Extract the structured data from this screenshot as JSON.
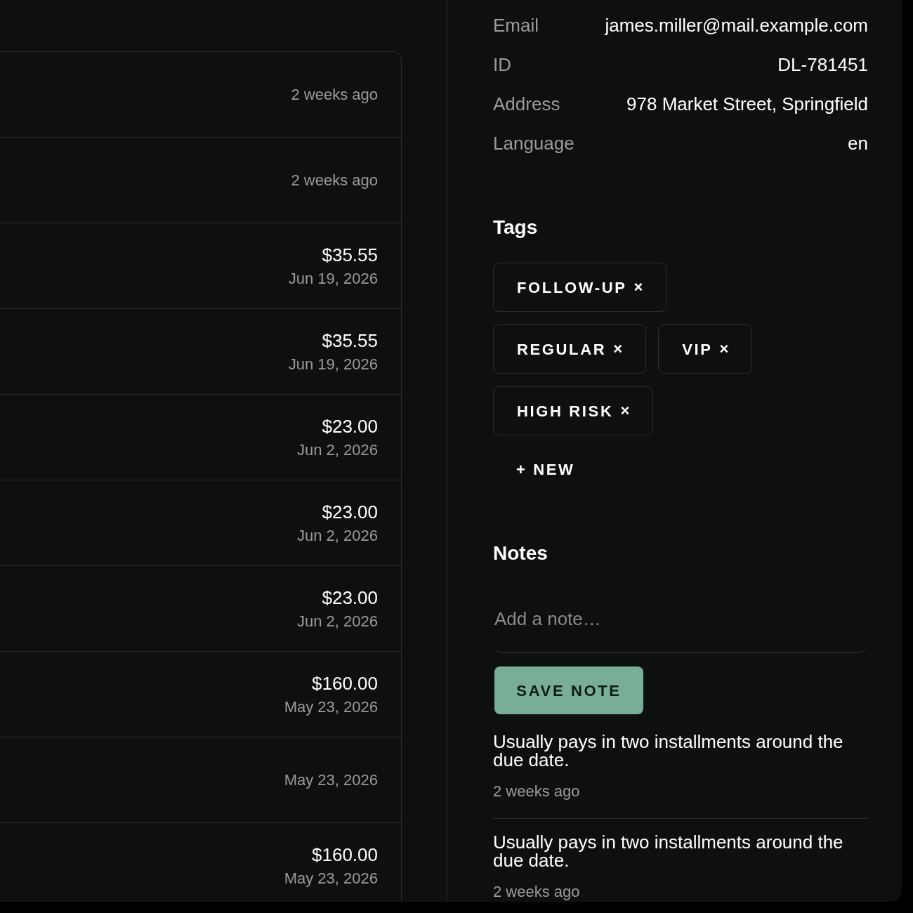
{
  "activity": [
    {
      "date": "2 weeks ago"
    },
    {
      "date": "2 weeks ago"
    },
    {
      "amount": "$35.55",
      "date": "Jun 19, 2026"
    },
    {
      "amount": "$35.55",
      "date": "Jun 19, 2026"
    },
    {
      "amount": "$23.00",
      "date": "Jun 2, 2026"
    },
    {
      "amount": "$23.00",
      "date": "Jun 2, 2026"
    },
    {
      "amount": "$23.00",
      "date": "Jun 2, 2026"
    },
    {
      "amount": "$160.00",
      "date": "May 23, 2026"
    },
    {
      "date": "May 23, 2026"
    },
    {
      "amount": "$160.00",
      "date": "May 23, 2026"
    }
  ],
  "details": [
    {
      "label": "Email",
      "value": "james.miller@mail.example.com"
    },
    {
      "label": "ID",
      "value": "DL-781451"
    },
    {
      "label": "Address",
      "value": "978 Market Street, Springfield"
    },
    {
      "label": "Language",
      "value": "en"
    }
  ],
  "tags": {
    "title": "Tags",
    "items": [
      {
        "label": "FOLLOW-UP",
        "remove": "×"
      },
      {
        "label": "REGULAR",
        "remove": "×"
      },
      {
        "label": "VIP",
        "remove": "×"
      },
      {
        "label": "HIGH RISK",
        "remove": "×"
      }
    ],
    "new_button": "+ NEW"
  },
  "notes": {
    "title": "Notes",
    "placeholder": "Add a note…",
    "save_button": "SAVE NOTE",
    "entries": [
      {
        "text": "Usually pays in two installments around the due date.",
        "time": "2 weeks ago"
      },
      {
        "text": "Usually pays in two installments around the due date.",
        "time": "2 weeks ago"
      }
    ]
  }
}
